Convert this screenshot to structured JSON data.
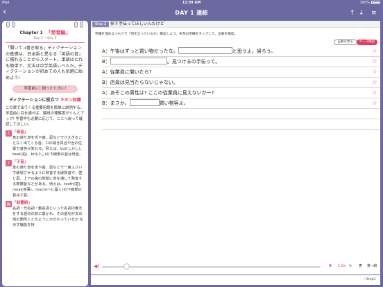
{
  "status": {
    "left": "iPad",
    "time": "11:59 AM",
    "battery": "100%"
  },
  "nav": {
    "title": "DAY 1 連結",
    "back": "‹"
  },
  "left": {
    "chapter": "Chapter 1",
    "chapter_title": "「発音編」",
    "days": "Day 1 ~ Day 9",
    "intro": "「聞いて→書き取る」ディクテーションの基礎は、日本語と異なる「英語の音」に慣れることからスタート。単語はどれも簡単で、文法は中学英語レベルだ。ディクテーションが初めての人も気軽に始めよう!",
    "pill": "学習前に! 困ったときに!",
    "section_prefix": "ディクテーションに役立つ",
    "section_highlight": "キホン知識",
    "body": "この章で出てくる重要用語を簡単に説明する。学習前に目を通せば、解説の理解度がぐんとアップ! 学習中も必要に応じて、ここへ戻って確認してほしい。",
    "terms": [
      {
        "name": "「母音」",
        "desc": "息の通り道を舌や歯、唇などでさえぎることなく出てくる音。口の開き具合や舌の位置で音色が変わる。例えば、but(しかし)、beat(拍)、bit(少し)の下線部の音は母音。"
      },
      {
        "name": "「子音」",
        "desc": "息の通り道を舌や歯、唇などで一度ふさいで破裂させるように発音する破裂音や、歯と唇、上下の歯の隙間に息を通して発音する摩擦音などがある。例えば、teeth(歯)、meal(食事)、reach(～に届く)の下線部の音は子音。"
      },
      {
        "name": "「前置詞」",
        "desc": "名詞・代名詞・動名詞といった名詞の働きをする語句の前に置かれ、その語句が文の他の箇所とどのようにかかわっているか を示す機能を持"
      }
    ],
    "page": "‹ Step1"
  },
  "main": {
    "step_label": "Step 2",
    "step_title": "探す手伝ってほしいんだけど",
    "instruction": "空欄を埋めるつもりで「何を言っているか」確認しよう。矢色の空欄をタップして、正解を確認。",
    "answer_button": "正解を見る",
    "check_button": "テーマ確認",
    "lines": [
      {
        "before": "A：午後はずっと買い物だったな。",
        "after": "と思うよ。帰ろう。",
        "blank": true
      },
      {
        "before": "B：",
        "after": "。見つけるの手伝って。",
        "blank": true
      },
      {
        "before": "A：従業員に聞いたら?",
        "after": "",
        "blank": false
      },
      {
        "before": "B：店員は見当たらないじゃない。",
        "after": "",
        "blank": false
      },
      {
        "before": "A：あそこの男性は? ここの従業員に見えないかー?",
        "after": "",
        "blank": false
      },
      {
        "before": "B：まさか。",
        "after": "買い物客よ。",
        "blank": true
      },
      {
        "before": "",
        "after": "",
        "blank": false
      },
      {
        "before": "",
        "after": "",
        "blank": false
      }
    ],
    "star": "☆"
  },
  "player": {
    "volume": "◀)",
    "pause": "II",
    "speed": "1.0x",
    "loop": "↻",
    "text_toggle": "表",
    "prev_next": "英→和"
  }
}
